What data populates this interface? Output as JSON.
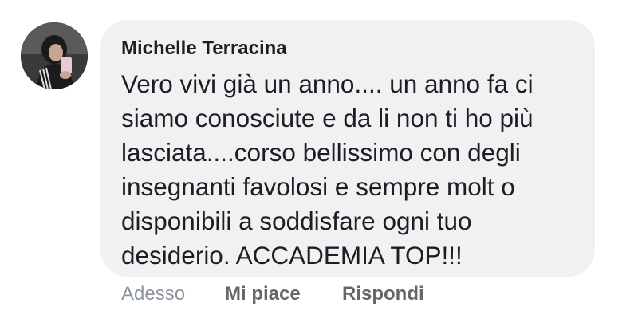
{
  "comment": {
    "author": "Michelle Terracina",
    "lines": [
      "Vero vivi già un anno.... un anno fa ci",
      "siamo conosciute e da li non ti ho più",
      "lasciata....corso bellissimo con degli",
      "insegnanti favolosi e sempre molt o",
      "disponibili a soddisfare ogni tuo",
      "desiderio. ACCADEMIA TOP!!!"
    ],
    "bubble_color": "#f0f1f3"
  },
  "actions": {
    "timestamp": "Adesso",
    "like_label": "Mi piace",
    "reply_label": "Rispondi"
  }
}
